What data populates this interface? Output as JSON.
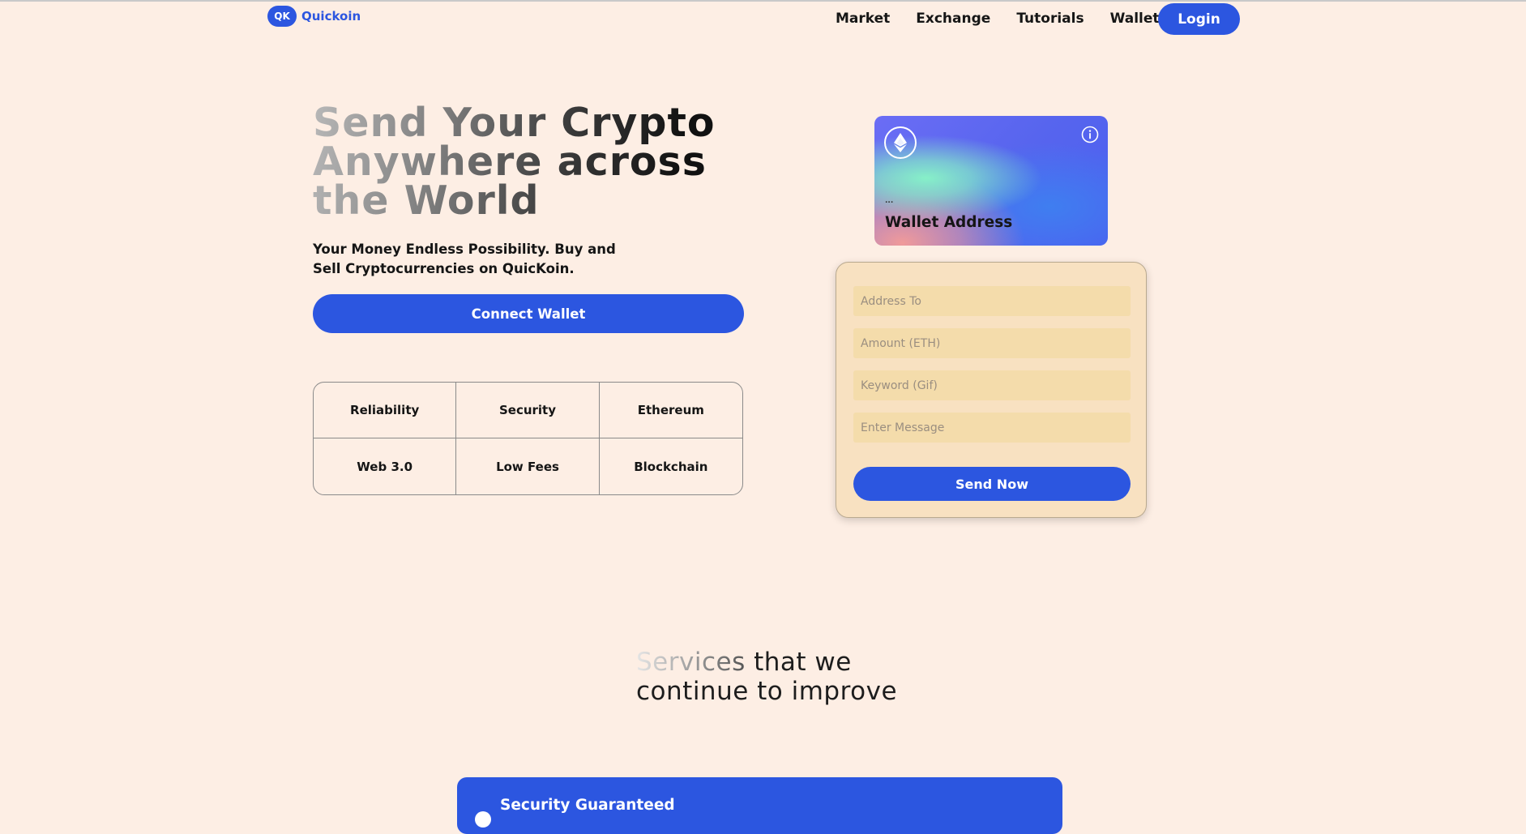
{
  "brand": {
    "badge": "QK",
    "name": "Quickoin",
    "accent_color": "#2c56e0",
    "background_color": "#fdeee4"
  },
  "nav": {
    "links": [
      "Market",
      "Exchange",
      "Tutorials",
      "Wallets"
    ],
    "login_label": "Login"
  },
  "hero": {
    "title": "Send Your Crypto Anywhere across the World",
    "subtitle": "Your Money Endless Possibility. Buy and Sell Cryptocurrencies on QuicKoin.",
    "connect_label": "Connect Wallet",
    "features": [
      "Reliability",
      "Security",
      "Ethereum",
      "Web 3.0",
      "Low Fees",
      "Blockchain"
    ]
  },
  "wallet_card": {
    "icon": "ethereum-icon",
    "info_icon": "info-icon",
    "address_short": "...",
    "label": "Wallet Address"
  },
  "send_form": {
    "address_placeholder": "Address To",
    "amount_placeholder": "Amount (ETH)",
    "keyword_placeholder": "Keyword (Gif)",
    "message_placeholder": "Enter Message",
    "submit_label": "Send Now"
  },
  "services": {
    "title_faded": "Services",
    "title_rest": " that we",
    "title_line2": "continue to improve",
    "cards": [
      {
        "title": "Security Guaranteed",
        "icon": "shield-icon"
      }
    ]
  }
}
